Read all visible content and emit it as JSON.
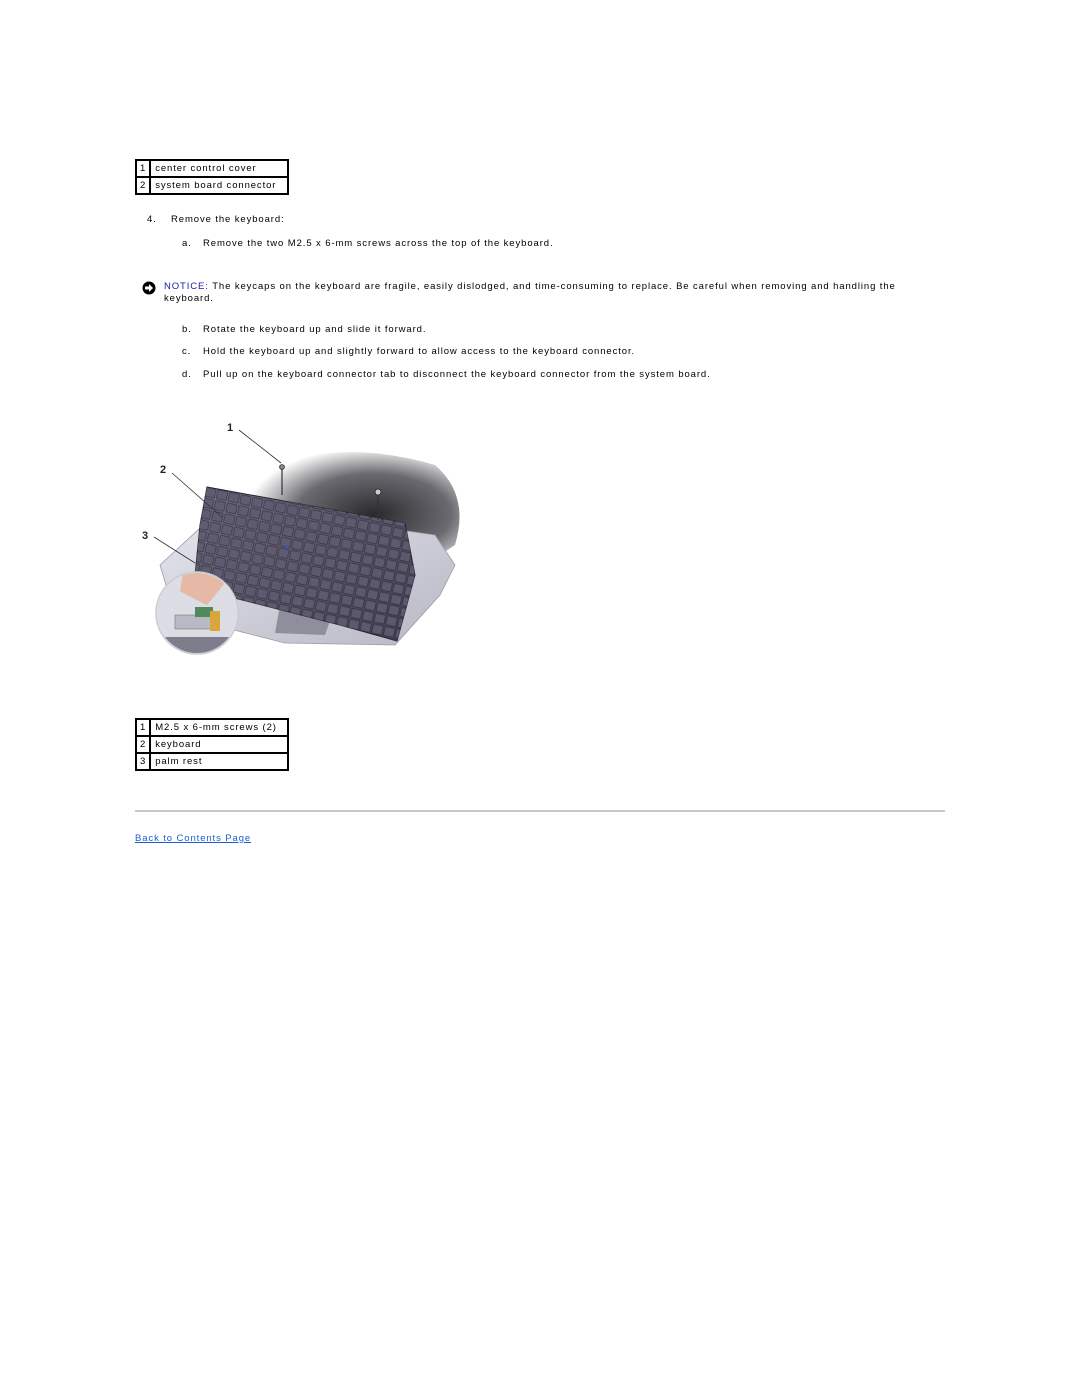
{
  "legend_top": {
    "rows": [
      {
        "num": "1",
        "label": "center control cover"
      },
      {
        "num": "2",
        "label": "system board connector"
      }
    ]
  },
  "step4": {
    "marker": "4.",
    "text": "Remove the keyboard:"
  },
  "substeps": [
    {
      "marker": "a.",
      "text": "Remove the two M2.5 x 6-mm screws across the top of the keyboard."
    },
    {
      "marker": "b.",
      "text": "Rotate the keyboard up and slide it forward."
    },
    {
      "marker": "c.",
      "text": "Hold the keyboard up and slightly forward to allow access to the keyboard connector."
    },
    {
      "marker": "d.",
      "text": "Pull up on the keyboard connector tab to disconnect the keyboard connector from the system board."
    }
  ],
  "notice": {
    "icon": "notice-arrow-icon",
    "label": "NOTICE:",
    "text": " The keycaps on the keyboard are fragile, easily dislodged, and time-consuming to replace. Be careful when removing and handling the keyboard."
  },
  "figure": {
    "callouts": [
      "1",
      "2",
      "3"
    ],
    "description": "keyboard removal illustration"
  },
  "legend_bottom": {
    "rows": [
      {
        "num": "1",
        "label": "M2.5 x 6-mm screws (2)"
      },
      {
        "num": "2",
        "label": "keyboard"
      },
      {
        "num": "3",
        "label": "palm rest"
      }
    ]
  },
  "footer": {
    "back_link": "Back to Contents Page"
  },
  "colors": {
    "notice_label": "#1a1aa6",
    "link": "#1a5fd0",
    "rule": "#c8c8c8"
  }
}
